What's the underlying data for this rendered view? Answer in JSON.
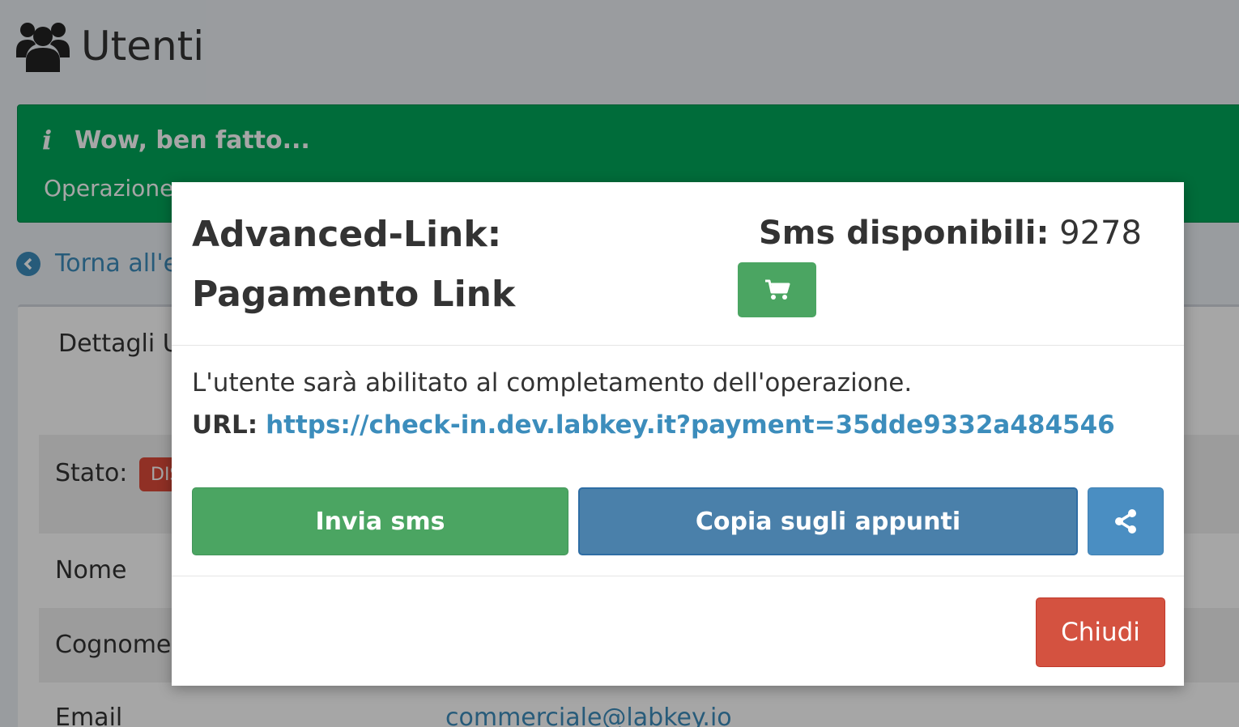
{
  "page": {
    "title": "Utenti",
    "title_icon": "users-icon",
    "alert": {
      "icon": "info-icon",
      "heading": "Wow, ben fatto...",
      "message": "Operazione"
    },
    "back_link": "Torna all'e",
    "box_title": "Dettagli U",
    "details": {
      "stato_label": "Stato:",
      "stato_badge": "DIS",
      "nome_label": "Nome",
      "cognome_label": "Cognome",
      "email_label": "Email",
      "email_value": "commerciale@labkey.io"
    }
  },
  "modal": {
    "title": "Advanced-Link: Pagamento Link",
    "sms_label": "Sms disponibili:",
    "sms_count": "9278",
    "cart_icon": "cart-icon",
    "body_text": "L'utente sarà abilitato al completamento dell'operazione.",
    "url_label": "URL:",
    "url": "https://check-in.dev.labkey.it?payment=35dde9332a484546",
    "send_sms_label": "Invia sms",
    "copy_label": "Copia sugli appunti",
    "share_icon": "share-icon",
    "close_label": "Chiudi"
  },
  "colors": {
    "success": "#4ba562",
    "primary": "#4a80aa",
    "danger": "#d45240",
    "link": "#3c8dbc"
  }
}
